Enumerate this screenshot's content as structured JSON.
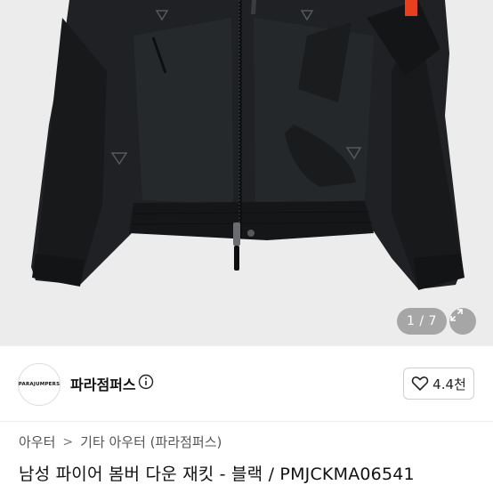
{
  "gallery": {
    "current_page": "1",
    "total_pages": "7",
    "page_indicator": "1 / 7"
  },
  "seller": {
    "avatar_text": "PARAJUMPERS",
    "name": "파라점퍼스",
    "rating": "4.4천"
  },
  "breadcrumb": {
    "items": [
      "아우터",
      "기타 아우터 (파라점퍼스)"
    ],
    "separator": ">"
  },
  "product": {
    "title": "남성 파이어 봄버 다운 재킷 - 블랙 / PMJCKMA06541"
  },
  "colors": {
    "hero_bg": "#ececec",
    "jacket": "#1f2124",
    "accent_tag": "#e8401c"
  },
  "icons": [
    "expand-icon",
    "info-icon",
    "heart-icon"
  ]
}
